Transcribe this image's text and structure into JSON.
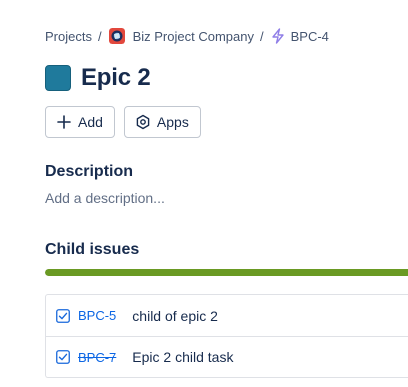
{
  "breadcrumb": {
    "projects_label": "Projects",
    "separator": "/",
    "project_name": "Biz Project Company",
    "issue_key": "BPC-4"
  },
  "issue": {
    "title": "Epic 2",
    "epic_color": "#1f7a9c"
  },
  "actions": {
    "add_label": "Add",
    "apps_label": "Apps"
  },
  "description": {
    "heading": "Description",
    "placeholder": "Add a description..."
  },
  "child_issues": {
    "heading": "Child issues",
    "progress_done_fraction": 1.0,
    "progress_color": "#6a9a23",
    "items": [
      {
        "key": "BPC-5",
        "summary": "child of epic 2",
        "status": "open",
        "icon": "task-checkbox-icon"
      },
      {
        "key": "BPC-7",
        "summary": "Epic 2 child task",
        "status": "done",
        "icon": "task-checkbox-icon"
      }
    ]
  },
  "colors": {
    "link": "#0c66e4",
    "text": "#172b4d",
    "subtle_text": "#626f86"
  }
}
